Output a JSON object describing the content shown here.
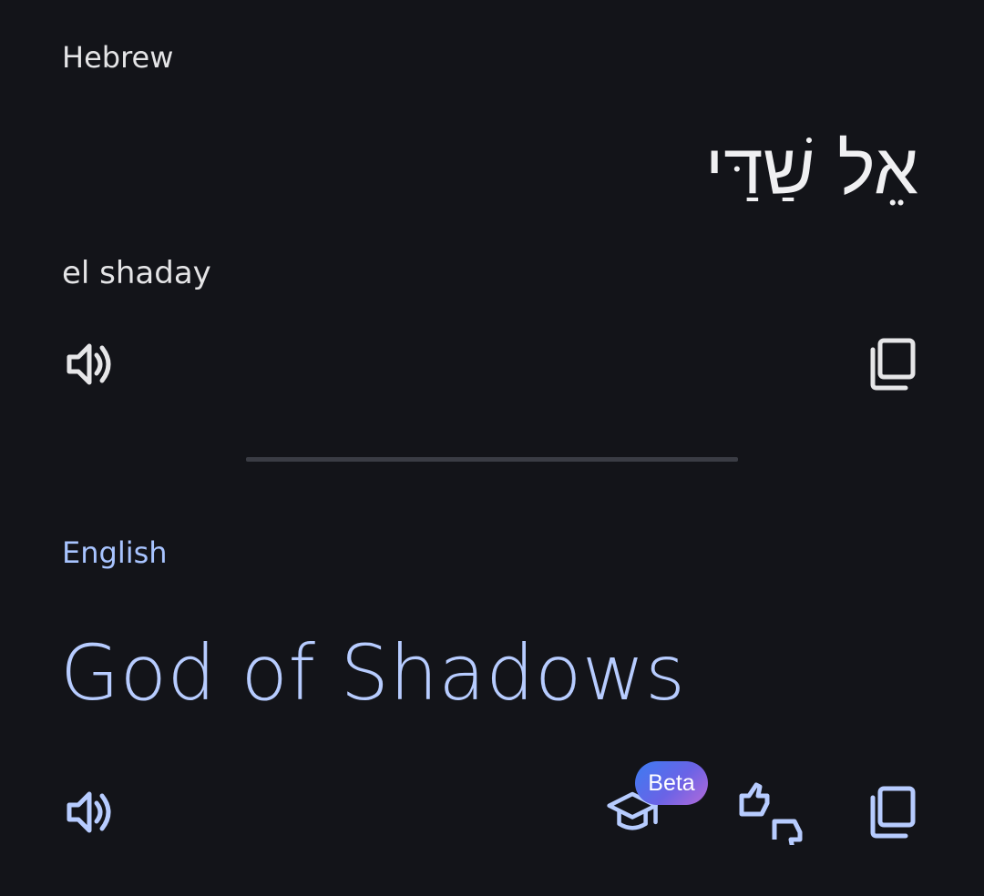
{
  "source": {
    "language": "Hebrew",
    "text": "אֵל שַׁדַּי",
    "transliteration": "el shaday"
  },
  "target": {
    "language": "English",
    "text": "God of Shadows",
    "beta_label": "Beta"
  },
  "icons": {
    "source_listen": "speaker-icon",
    "source_copy": "copy-icon",
    "target_listen": "speaker-icon",
    "target_learn": "graduation-cap-icon",
    "target_feedback": "thumbs-up-down-icon",
    "target_copy": "copy-icon"
  },
  "colors": {
    "background": "#131419",
    "accent": "#a8c4ff",
    "badge_start": "#3c7cf2",
    "badge_end": "#b46ad9"
  }
}
